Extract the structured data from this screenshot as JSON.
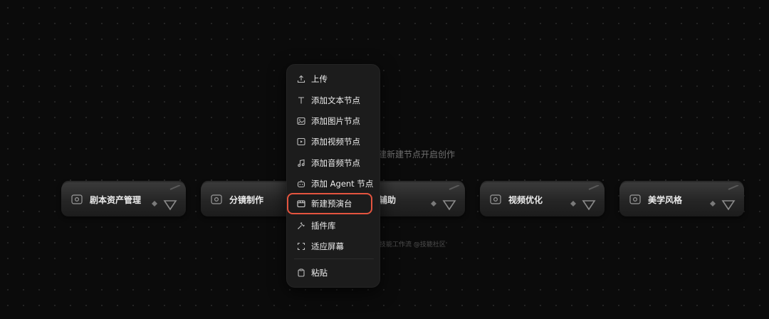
{
  "canvas": {
    "hint_text": "建新建节点开启创作",
    "watermark": "技能工作流 @技能社区"
  },
  "cards": [
    {
      "title": "剧本资产管理",
      "icon": "image-node-icon"
    },
    {
      "title": "分镜制作",
      "icon": "image-node-icon"
    },
    {
      "title": "辅助",
      "icon": "image-node-icon"
    },
    {
      "title": "视频优化",
      "icon": "image-node-icon"
    },
    {
      "title": "美学风格",
      "icon": "image-node-icon"
    }
  ],
  "context_menu": {
    "items": [
      {
        "label": "上传",
        "icon": "upload-icon"
      },
      {
        "label": "添加文本节点",
        "icon": "text-icon"
      },
      {
        "label": "添加图片节点",
        "icon": "image-icon"
      },
      {
        "label": "添加视频节点",
        "icon": "video-icon"
      },
      {
        "label": "添加音频节点",
        "icon": "music-icon"
      },
      {
        "label": "添加 Agent 节点",
        "icon": "agent-icon"
      },
      {
        "label": "新建预演台",
        "icon": "stage-icon",
        "highlighted": true
      },
      {
        "label": "插件库",
        "icon": "plugin-icon"
      },
      {
        "label": "适应屏幕",
        "icon": "fit-screen-icon"
      },
      {
        "label": "粘贴",
        "icon": "paste-icon"
      }
    ]
  },
  "colors": {
    "background": "#0b0b0b",
    "menu_background": "#1c1c1c",
    "highlight_border": "#e4543f"
  }
}
